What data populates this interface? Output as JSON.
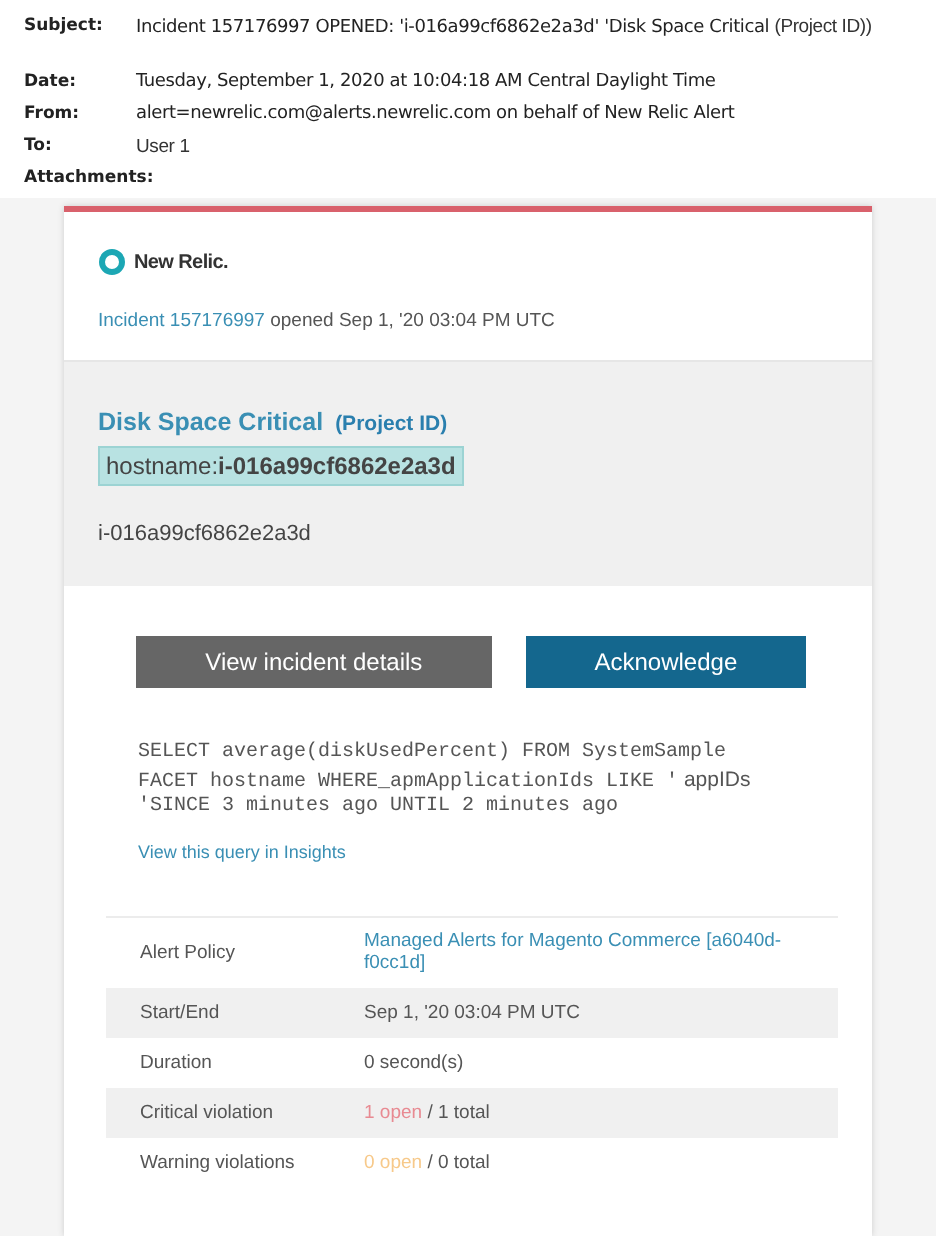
{
  "email_header": {
    "fields": [
      {
        "label": "Subject:",
        "parts": [
          {
            "text": "Incident 157176997 OPENED: 'i-016a99cf6862e2a3d' 'Disk Space Critical ",
            "kind": "main"
          },
          {
            "text": "(Project ID))",
            "kind": "alt"
          }
        ]
      },
      {
        "label": "Date:",
        "parts": [
          {
            "text": "Tuesday, September 1, 2020 at 10:04:18 AM Central Daylight Time",
            "kind": "main"
          }
        ]
      },
      {
        "label": "From:",
        "parts": [
          {
            "text": "alert=newrelic.com@alerts.newrelic.com on behalf of New Relic Alert",
            "kind": "main"
          }
        ]
      },
      {
        "label": "To:",
        "parts": [
          {
            "text": "User 1",
            "kind": "alt"
          }
        ]
      },
      {
        "label": "Attachments:"
      }
    ]
  },
  "card": {
    "logo": "New Relic.",
    "incident_link": "Incident 157176997",
    "incident_text": " opened Sep 1, '20 03:04 PM UTC",
    "condition": "Disk Space Critical",
    "condition_note": "(Project ID)",
    "target_label": "hostname:",
    "target_value": "i-016a99cf6862e2a3d",
    "entity": "i-016a99cf6862e2a3d",
    "buttons": [
      {
        "label": "View incident details",
        "kind": "secondary"
      },
      {
        "label": "Acknowledge",
        "kind": "primary"
      }
    ],
    "query": [
      {
        "text": "SELECT average(diskUsedPercent) FROM SystemSample FACET hostname WHERE_apmApplicationIds LIKE '",
        "kind": "code"
      },
      {
        "text": " appIDs ",
        "kind": "placeholder"
      },
      {
        "text": "'SINCE 3 minutes ago UNTIL 2 minutes ago",
        "kind": "code"
      }
    ],
    "query_link": "View this query in Insights",
    "details": [
      {
        "label": "Alert Policy",
        "kind": "link",
        "value": "Managed Alerts for Magento Commerce [a6040d-f0cc1d]"
      },
      {
        "label": "Start/End",
        "kind": "text",
        "value": "Sep 1, '20 03:04 PM UTC"
      },
      {
        "label": "Duration",
        "kind": "text",
        "value": "0 second(s)"
      },
      {
        "label": "Critical violation",
        "kind": "violation",
        "open": "1 open",
        "total": " / 1 total",
        "color": "#e88a92"
      },
      {
        "label": "Warning violations",
        "kind": "violation",
        "open": "0 open",
        "total": " / 0 total",
        "color": "#f7c98a"
      }
    ]
  }
}
